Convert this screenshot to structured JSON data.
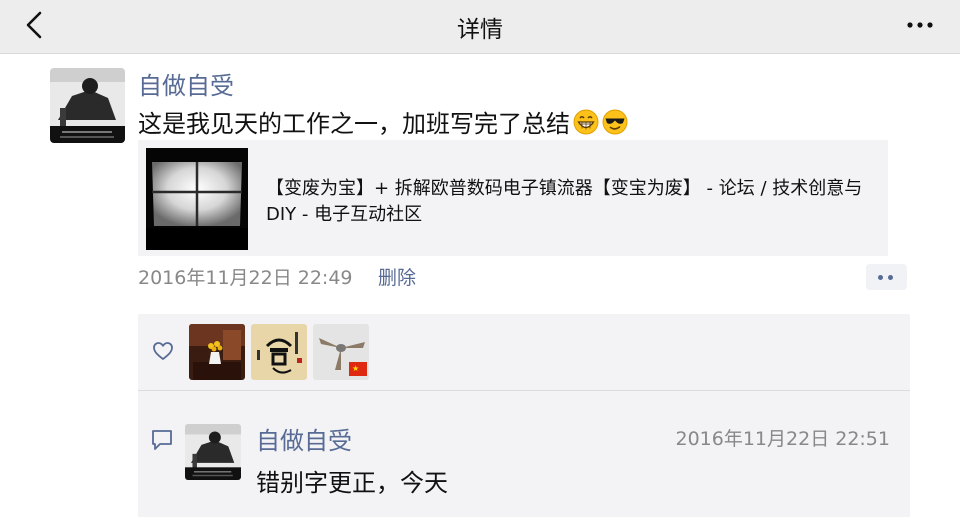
{
  "nav": {
    "title": "详情",
    "back_icon": "chevron-left-icon",
    "more_icon": "more-icon"
  },
  "post": {
    "author": "自做自受",
    "text": "这是我见天的工作之一，加班写完了总结",
    "emojis": [
      "grin-emoji",
      "sunglasses-emoji"
    ],
    "link": {
      "title": "【变废为宝】+ 拆解欧普数码电子镇流器【变宝为废】 - 论坛 / 技术创意与 DIY - 电子互动社区"
    },
    "time": "2016年11月22日 22:49",
    "delete_label": "删除"
  },
  "likes": {
    "icon": "heart-icon",
    "users": [
      "like-avatar-1",
      "like-avatar-2",
      "like-avatar-3"
    ]
  },
  "comments": [
    {
      "author": "自做自受",
      "time": "2016年11月22日 22:51",
      "text": "错别字更正，今天"
    }
  ],
  "colors": {
    "link_blue": "#576b95",
    "nav_bg": "#ededed",
    "section_bg": "#f3f3f5",
    "meta_gray": "#888888"
  }
}
